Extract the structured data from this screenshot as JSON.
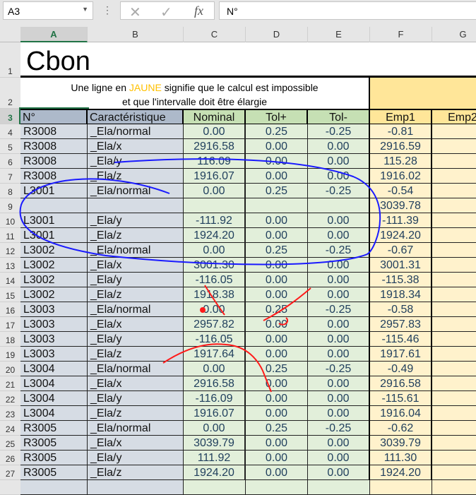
{
  "formula_bar": {
    "name_box": "A3",
    "formula": "N°",
    "cancel_icon": "✕",
    "enter_icon": "✓",
    "fx_label": "fx"
  },
  "columns": [
    "A",
    "B",
    "C",
    "D",
    "E",
    "F",
    "G"
  ],
  "title": "Cbon",
  "note": {
    "pre": "Une ligne en ",
    "highlight": "JAUNE",
    "post": " signifie que le calcul est impossible",
    "line2": "et que l'intervalle doit être élargie"
  },
  "headers": [
    "N°",
    "Caractéristique",
    "Nominal",
    "Tol+",
    "Tol-",
    "Emp1",
    "Emp2"
  ],
  "row_numbers": [
    "1",
    "2",
    "3"
  ],
  "rows": [
    [
      "4",
      "R3008",
      "_Ela/normal",
      "0.00",
      "0.25",
      "-0.25",
      "-0.81"
    ],
    [
      "5",
      "R3008",
      "_Ela/x",
      "2916.58",
      "0.00",
      "0.00",
      "2916.59"
    ],
    [
      "6",
      "R3008",
      "_Ela/y",
      "116.09",
      "0.00",
      "0.00",
      "115.28"
    ],
    [
      "7",
      "R3008",
      "_Ela/z",
      "1916.07",
      "0.00",
      "0.00",
      "1916.02"
    ],
    [
      "8",
      "L3001",
      "_Ela/normal",
      "0.00",
      "0.25",
      "-0.25",
      "-0.54"
    ],
    [
      "9",
      "",
      "",
      "",
      "",
      "",
      "3039.78"
    ],
    [
      "10",
      "L3001",
      "_Ela/y",
      "-111.92",
      "0.00",
      "0.00",
      "-111.39"
    ],
    [
      "11",
      "L3001",
      "_Ela/z",
      "1924.20",
      "0.00",
      "0.00",
      "1924.20"
    ],
    [
      "12",
      "L3002",
      "_Ela/normal",
      "0.00",
      "0.25",
      "-0.25",
      "-0.67"
    ],
    [
      "13",
      "L3002",
      "_Ela/x",
      "3001.30",
      "0.00",
      "0.00",
      "3001.31"
    ],
    [
      "14",
      "L3002",
      "_Ela/y",
      "-116.05",
      "0.00",
      "0.00",
      "-115.38"
    ],
    [
      "15",
      "L3002",
      "_Ela/z",
      "1918.38",
      "0.00",
      "0.00",
      "1918.34"
    ],
    [
      "16",
      "L3003",
      "_Ela/normal",
      "0.00",
      "0.25",
      "-0.25",
      "-0.58"
    ],
    [
      "17",
      "L3003",
      "_Ela/x",
      "2957.82",
      "0.00",
      "0.00",
      "2957.83"
    ],
    [
      "18",
      "L3003",
      "_Ela/y",
      "-116.05",
      "0.00",
      "0.00",
      "-115.46"
    ],
    [
      "19",
      "L3003",
      "_Ela/z",
      "1917.64",
      "0.00",
      "0.00",
      "1917.61"
    ],
    [
      "20",
      "L3004",
      "_Ela/normal",
      "0.00",
      "0.25",
      "-0.25",
      "-0.49"
    ],
    [
      "21",
      "L3004",
      "_Ela/x",
      "2916.58",
      "0.00",
      "0.00",
      "2916.58"
    ],
    [
      "22",
      "L3004",
      "_Ela/y",
      "-116.09",
      "0.00",
      "0.00",
      "-115.61"
    ],
    [
      "23",
      "L3004",
      "_Ela/z",
      "1916.07",
      "0.00",
      "0.00",
      "1916.04"
    ],
    [
      "24",
      "R3005",
      "_Ela/normal",
      "0.00",
      "0.25",
      "-0.25",
      "-0.62"
    ],
    [
      "25",
      "R3005",
      "_Ela/x",
      "3039.79",
      "0.00",
      "0.00",
      "3039.79"
    ],
    [
      "26",
      "R3005",
      "_Ela/y",
      "111.92",
      "0.00",
      "0.00",
      "111.30"
    ],
    [
      "27",
      "R3005",
      "_Ela/z",
      "1924.20",
      "0.00",
      "0.00",
      "1924.20"
    ]
  ],
  "colors": {
    "annotation_blue": "#1a1aff",
    "annotation_red": "#ff1a1a"
  }
}
